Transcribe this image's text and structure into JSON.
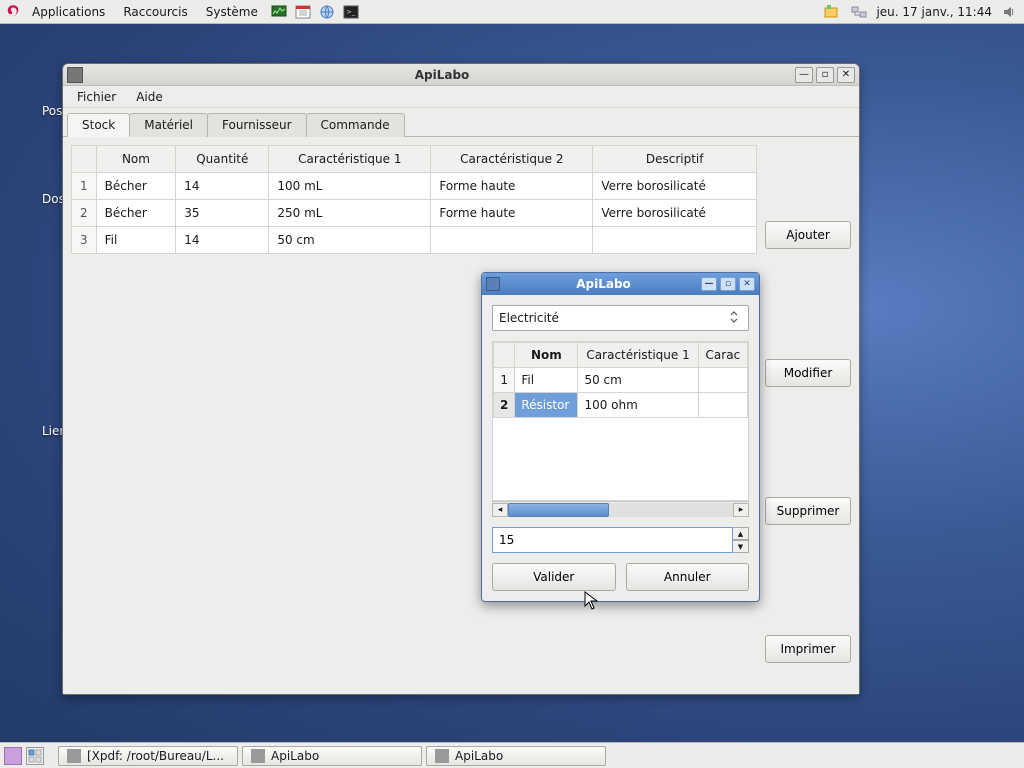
{
  "panel": {
    "menus": [
      "Applications",
      "Raccourcis",
      "Système"
    ],
    "clock": "jeu. 17 janv., 11:44"
  },
  "desktop_labels": {
    "a": "Pos",
    "b": "Doss",
    "c": "Lien ve"
  },
  "main": {
    "title": "ApiLabo",
    "menubar": [
      "Fichier",
      "Aide"
    ],
    "tabs": [
      "Stock",
      "Matériel",
      "Fournisseur",
      "Commande"
    ],
    "active_tab": 0,
    "headers": [
      "",
      "Nom",
      "Quantité",
      "Caractéristique 1",
      "Caractéristique 2",
      "Descriptif"
    ],
    "rows": [
      {
        "n": "1",
        "nom": "Bécher",
        "q": "14",
        "c1": "100 mL",
        "c2": "Forme haute",
        "d": "Verre borosilicaté"
      },
      {
        "n": "2",
        "nom": "Bécher",
        "q": "35",
        "c1": "250 mL",
        "c2": "Forme haute",
        "d": "Verre borosilicaté"
      },
      {
        "n": "3",
        "nom": "Fil",
        "q": "14",
        "c1": "50 cm",
        "c2": "",
        "d": ""
      }
    ],
    "buttons": {
      "add": "Ajouter",
      "edit": "Modifier",
      "del": "Supprimer",
      "print": "Imprimer"
    }
  },
  "dialog": {
    "title": "ApiLabo",
    "combo_value": "Electricité",
    "headers": [
      "",
      "Nom",
      "Caractéristique 1",
      "Carac"
    ],
    "rows": [
      {
        "n": "1",
        "nom": "Fil",
        "c1": "50 cm"
      },
      {
        "n": "2",
        "nom": "Résistor",
        "c1": "100 ohm"
      }
    ],
    "selected_row": 1,
    "spin_value": "15",
    "validate": "Valider",
    "cancel": "Annuler"
  },
  "taskbar": {
    "items": [
      "[Xpdf: /root/Bureau/L...",
      "ApiLabo",
      "ApiLabo"
    ]
  }
}
